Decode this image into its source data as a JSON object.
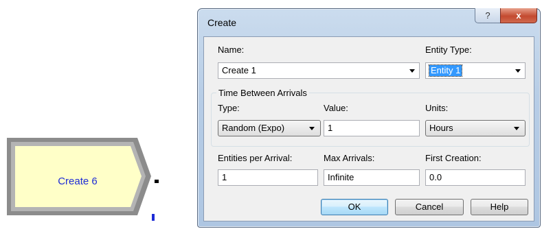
{
  "module": {
    "label": "Create 6",
    "type": "create-module"
  },
  "dialog": {
    "title": "Create",
    "help_glyph": "?",
    "close_glyph": "x",
    "name_label": "Name:",
    "name_value": "Create 1",
    "entity_type_label": "Entity Type:",
    "entity_type_value": "Entity 1",
    "time_group_label": "Time Between Arrivals",
    "type_label": "Type:",
    "type_value": "Random (Expo)",
    "value_label": "Value:",
    "value_value": "1",
    "units_label": "Units:",
    "units_value": "Hours",
    "entities_per_arrival_label": "Entities per Arrival:",
    "entities_per_arrival_value": "1",
    "max_arrivals_label": "Max Arrivals:",
    "max_arrivals_value": "Infinite",
    "first_creation_label": "First Creation:",
    "first_creation_value": "0.0",
    "ok_label": "OK",
    "cancel_label": "Cancel",
    "help_label": "Help"
  },
  "colors": {
    "module_fill": "#ffffc8",
    "module_label": "#1d2bd6",
    "selection": "#3399ff"
  }
}
